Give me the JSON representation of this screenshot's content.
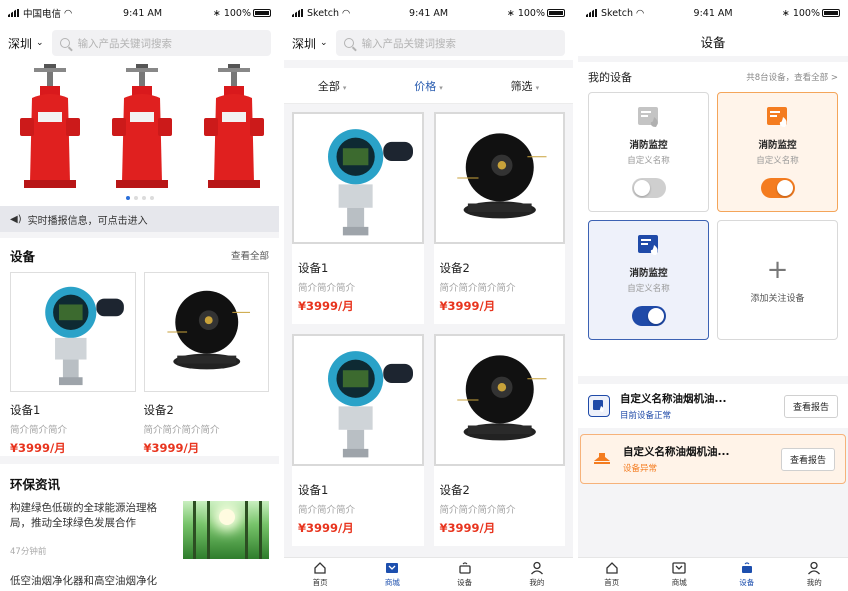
{
  "colors": {
    "accent": "#2a5db0",
    "price": "#e8341e",
    "orange": "#f47c20",
    "blue": "#1f4aa8"
  },
  "screen1": {
    "status": {
      "carrier": "中国电信",
      "time": "9:41 AM",
      "battery": "100%"
    },
    "search": {
      "city": "深圳",
      "placeholder": "输入产品关键词搜索"
    },
    "notice": "实时播报信息，可点击进入",
    "devices": {
      "title": "设备",
      "more": "查看全部",
      "items": [
        {
          "name": "设备1",
          "desc": "简介简介简介",
          "price": "¥3999/月"
        },
        {
          "name": "设备2",
          "desc": "简介简介简介简介",
          "price": "¥3999/月"
        }
      ]
    },
    "news": {
      "title": "环保资讯",
      "items": [
        {
          "title": "构建绿色低碳的全球能源治理格局，推动全球绿色发展合作",
          "time": "47分钟前"
        },
        {
          "title": "低空油烟净化器和高空油烟净化"
        }
      ]
    }
  },
  "screen2": {
    "status": {
      "carrier": "Sketch",
      "time": "9:41 AM",
      "battery": "100%"
    },
    "search": {
      "city": "深圳",
      "placeholder": "输入产品关键词搜索"
    },
    "filters": [
      "全部",
      "价格",
      "筛选"
    ],
    "products": [
      {
        "name": "设备1",
        "desc": "简介简介简介",
        "price": "¥3999/月"
      },
      {
        "name": "设备2",
        "desc": "简介简介简介简介",
        "price": "¥3999/月"
      },
      {
        "name": "设备1",
        "desc": "简介简介简介",
        "price": "¥3999/月"
      },
      {
        "name": "设备2",
        "desc": "简介简介简介简介",
        "price": "¥3999/月"
      }
    ],
    "tabs": [
      "首页",
      "商城",
      "设备",
      "我的"
    ]
  },
  "screen3": {
    "status": {
      "carrier": "Sketch",
      "time": "9:41 AM",
      "battery": "100%"
    },
    "title": "设备",
    "my_devices": {
      "title": "我的设备",
      "more": "共8台设备，查看全部 >"
    },
    "devices": [
      {
        "name": "消防监控",
        "sub": "自定义名称",
        "on": false
      },
      {
        "name": "消防监控",
        "sub": "自定义名称",
        "on": true
      },
      {
        "name": "消防监控",
        "sub": "自定义名称",
        "on": true
      }
    ],
    "add_label": "添加关注设备",
    "reports": [
      {
        "name": "自定义名称油烟机油...",
        "status": "目前设备正常",
        "button": "查看报告"
      },
      {
        "name": "自定义名称油烟机油...",
        "status": "设备异常",
        "button": "查看报告"
      }
    ],
    "tabs": [
      "首页",
      "商城",
      "设备",
      "我的"
    ]
  }
}
